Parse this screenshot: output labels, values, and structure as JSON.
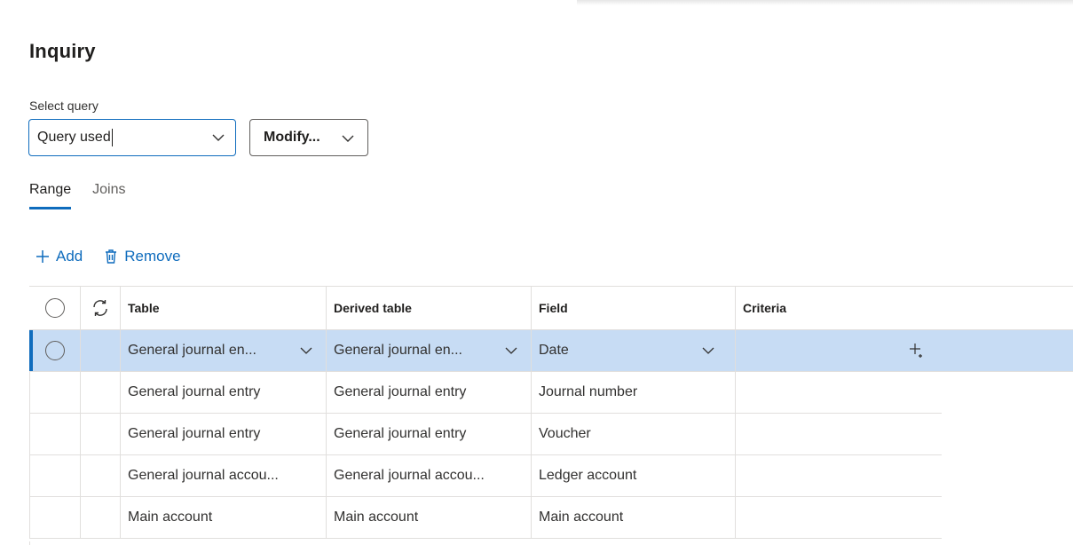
{
  "page": {
    "title": "Inquiry",
    "select_query_label": "Select query",
    "query_value": "Query used",
    "modify_label": "Modify..."
  },
  "tabs": [
    {
      "label": "Range",
      "active": true
    },
    {
      "label": "Joins",
      "active": false
    }
  ],
  "commands": {
    "add_label": "Add",
    "remove_label": "Remove"
  },
  "grid": {
    "columns": [
      "Table",
      "Derived table",
      "Field",
      "Criteria"
    ],
    "rows": [
      {
        "table": "General journal en...",
        "derived": "General journal en...",
        "field": "Date",
        "criteria": "",
        "selected": true
      },
      {
        "table": "General journal entry",
        "derived": "General journal entry",
        "field": "Journal number",
        "criteria": ""
      },
      {
        "table": "General journal entry",
        "derived": "General journal entry",
        "field": "Voucher",
        "criteria": ""
      },
      {
        "table": "General journal accou...",
        "derived": "General journal accou...",
        "field": "Ledger account",
        "criteria": ""
      },
      {
        "table": "Main account",
        "derived": "Main account",
        "field": "Main account",
        "criteria": ""
      }
    ]
  },
  "colors": {
    "accent": "#0f6cbd",
    "selected_row": "#c7dcf4",
    "border": "#e1dfdd"
  },
  "icons": {
    "query_dropdown": "chevron-down-icon",
    "modify_dropdown": "chevron-down-icon",
    "add": "plus-icon",
    "remove": "trash-icon",
    "refresh": "refresh-icon",
    "cursor": "crosshair-cursor-icon"
  }
}
